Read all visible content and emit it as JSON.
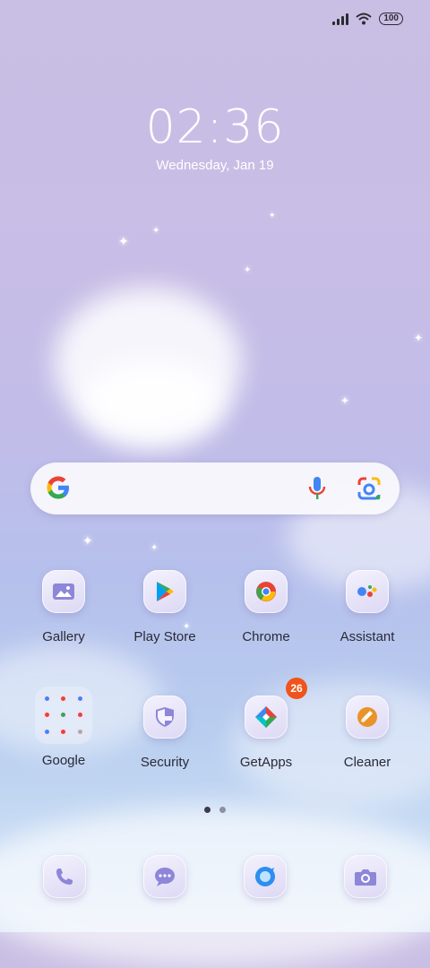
{
  "status_bar": {
    "battery": "100"
  },
  "lock": {
    "time": "02:36",
    "date": "Wednesday, Jan 19"
  },
  "search": {
    "logo": "G"
  },
  "apps": [
    {
      "label": "Gallery",
      "icon": "gallery-icon"
    },
    {
      "label": "Play Store",
      "icon": "play-store-icon"
    },
    {
      "label": "Chrome",
      "icon": "chrome-icon"
    },
    {
      "label": "Assistant",
      "icon": "assistant-icon"
    },
    {
      "label": "Google",
      "icon": "google-folder-icon"
    },
    {
      "label": "Security",
      "icon": "security-icon"
    },
    {
      "label": "GetApps",
      "icon": "getapps-icon",
      "badge": "26"
    },
    {
      "label": "Cleaner",
      "icon": "cleaner-icon"
    }
  ],
  "dock": [
    {
      "icon": "phone-icon"
    },
    {
      "icon": "messages-icon"
    },
    {
      "icon": "browser-icon"
    },
    {
      "icon": "camera-icon"
    }
  ],
  "colors": {
    "icon_tint": "#8d86d9",
    "badge": "#f0541c",
    "text": "#2a2a36"
  }
}
